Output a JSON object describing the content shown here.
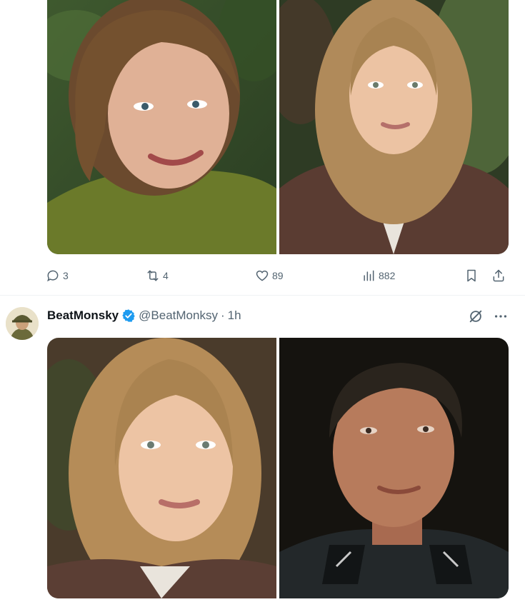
{
  "tweet1": {
    "actions": {
      "replies": "3",
      "retweets": "4",
      "likes": "89",
      "views": "882"
    }
  },
  "tweet2": {
    "author": {
      "display_name": "BeatMonsky",
      "handle": "@BeatMonksy",
      "verified": true
    },
    "separator": "·",
    "time": "1h"
  },
  "icons": {
    "reply": "reply-icon",
    "retweet": "retweet-icon",
    "like": "heart-icon",
    "views": "views-icon",
    "bookmark": "bookmark-icon",
    "share": "share-icon",
    "verified": "verified-badge-icon",
    "grok": "grok-icon",
    "more": "more-icon"
  },
  "colors": {
    "text_primary": "#0f1419",
    "text_secondary": "#536471",
    "verified_blue": "#1d9bf0",
    "divider": "#eff3f4"
  }
}
